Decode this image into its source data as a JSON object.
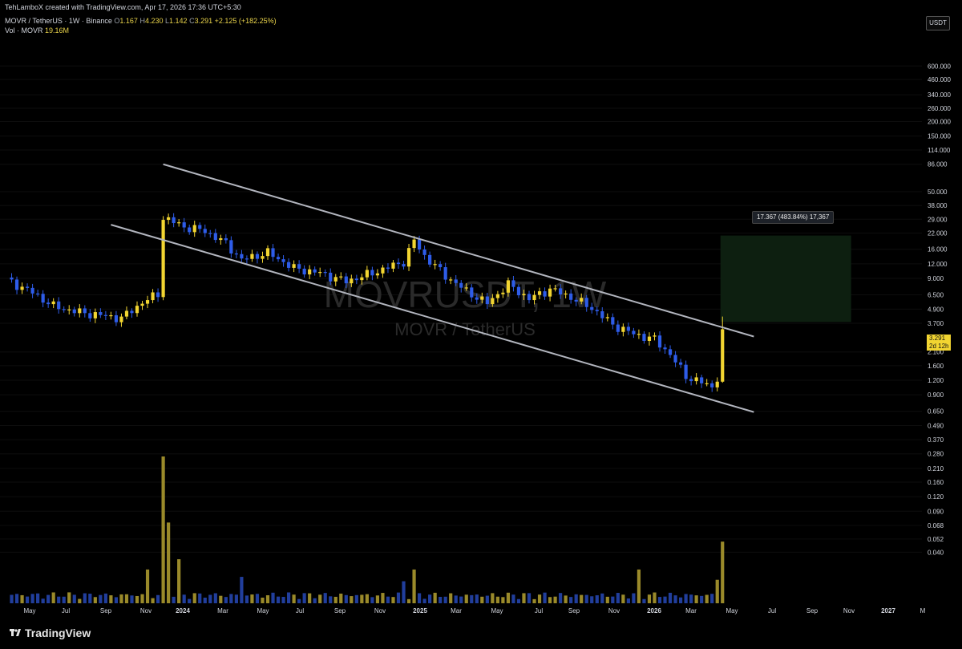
{
  "header": {
    "credit": "TehLamboX created with TradingView.com, Apr 17, 2026 17:36 UTC+5:30",
    "symbol_desc": "MOVR / TetherUS · 1W · Binance",
    "ohlc": {
      "o_label": "O",
      "o": "1.167",
      "h_label": "H",
      "h": "4.230",
      "l_label": "L",
      "l": "1.142",
      "c_label": "C",
      "c": "3.291",
      "change": "+2.125 (+182.25%)"
    },
    "vol_label": "Vol · MOVR",
    "vol_value": "19.16M"
  },
  "currency_button": "USDT",
  "watermark": {
    "symbol": "MOVRUSDT, 1W",
    "name": "MOVR / TetherUS"
  },
  "price_tag": {
    "price": "3.291",
    "countdown": "2d 12h"
  },
  "target_label": "17.367 (483.84%) 17,367",
  "brand": "TradingView",
  "colors": {
    "up": "#f2d531",
    "down": "#2e5ce8",
    "vol_up": "#9a8a2a",
    "vol_down": "#213e9c",
    "channel": "#b2b5be",
    "target_zone": "#0d1f10"
  },
  "chart_data": {
    "type": "candlestick",
    "title": "MOVRUSDT, 1W",
    "scale": "log",
    "y_ticks": [
      "600.000",
      "460.000",
      "340.000",
      "260.000",
      "200.000",
      "150.000",
      "114.000",
      "86.000",
      "50.000",
      "38.000",
      "29.000",
      "22.000",
      "16.000",
      "12.000",
      "9.000",
      "6.500",
      "4.900",
      "3.700",
      "2.100",
      "1.600",
      "1.200",
      "0.900",
      "0.650",
      "0.490",
      "0.370",
      "0.280",
      "0.210",
      "0.160",
      "0.120",
      "0.090",
      "0.068",
      "0.052",
      "0.040"
    ],
    "x_ticks": [
      "May",
      "Jul",
      "Sep",
      "Nov",
      "2024",
      "Mar",
      "May",
      "Jul",
      "Sep",
      "Nov",
      "2025",
      "Mar",
      "May",
      "Jul",
      "Sep",
      "Nov",
      "2026",
      "Mar",
      "May",
      "Jul",
      "Sep",
      "Nov",
      "2027",
      "M"
    ],
    "anchors": [
      {
        "week": 0,
        "price": 8.8
      },
      {
        "week": 5,
        "price": 6.8
      },
      {
        "week": 9,
        "price": 5.2
      },
      {
        "week": 14,
        "price": 4.6
      },
      {
        "week": 22,
        "price": 4.1
      },
      {
        "week": 26,
        "price": 5.6
      },
      {
        "week": 29,
        "price": 6.6
      },
      {
        "week": 30,
        "price": 30
      },
      {
        "week": 34,
        "price": 25
      },
      {
        "week": 38,
        "price": 23
      },
      {
        "week": 42,
        "price": 18
      },
      {
        "week": 45,
        "price": 13
      },
      {
        "week": 50,
        "price": 15
      },
      {
        "week": 55,
        "price": 11
      },
      {
        "week": 60,
        "price": 10
      },
      {
        "week": 65,
        "price": 8.5
      },
      {
        "week": 70,
        "price": 10
      },
      {
        "week": 76,
        "price": 12.5
      },
      {
        "week": 78,
        "price": 19
      },
      {
        "week": 80,
        "price": 14
      },
      {
        "week": 84,
        "price": 9.5
      },
      {
        "week": 88,
        "price": 7
      },
      {
        "week": 92,
        "price": 5.5
      },
      {
        "week": 96,
        "price": 8
      },
      {
        "week": 100,
        "price": 6
      },
      {
        "week": 104,
        "price": 7.3
      },
      {
        "week": 108,
        "price": 6.2
      },
      {
        "week": 112,
        "price": 5
      },
      {
        "week": 116,
        "price": 3.6
      },
      {
        "week": 120,
        "price": 3.0
      },
      {
        "week": 124,
        "price": 2.7
      },
      {
        "week": 127,
        "price": 2.0
      },
      {
        "week": 130,
        "price": 1.3
      },
      {
        "week": 134,
        "price": 1.1
      },
      {
        "week": 135,
        "price": 1.05
      },
      {
        "week": 136,
        "price": 1.167
      }
    ],
    "last_candle": {
      "open": 1.167,
      "high": 4.23,
      "low": 1.142,
      "close": 3.291
    },
    "volume_spikes": [
      {
        "week": 30,
        "value": 1.0
      },
      {
        "week": 31,
        "value": 0.55
      },
      {
        "week": 33,
        "value": 0.3
      },
      {
        "week": 27,
        "value": 0.23
      },
      {
        "week": 45,
        "value": 0.18
      },
      {
        "week": 78,
        "value": 0.23
      },
      {
        "week": 76,
        "value": 0.15
      },
      {
        "week": 121,
        "value": 0.23
      },
      {
        "week": 137,
        "value": 0.42
      },
      {
        "week": 136,
        "value": 0.16
      }
    ],
    "channel": {
      "upper": [
        {
          "week": 30,
          "price": 86
        },
        {
          "week": 143,
          "price": 2.85
        }
      ],
      "lower": [
        {
          "week": 20,
          "price": 26
        },
        {
          "week": 143,
          "price": 0.64
        }
      ]
    },
    "target_zone": {
      "price_low": 3.8,
      "price_high": 21,
      "week_start": 136,
      "week_end": 161
    }
  }
}
